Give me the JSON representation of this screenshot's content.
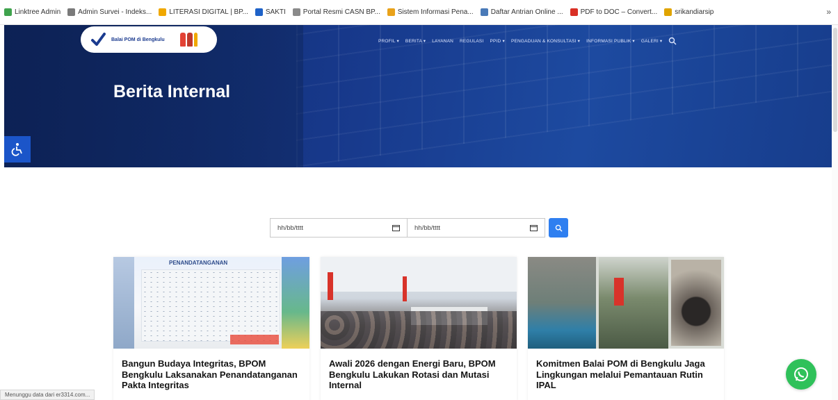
{
  "bookmarks": [
    {
      "label": "Linktree Admin",
      "color": "#3fa34d"
    },
    {
      "label": "Admin Survei - Indeks...",
      "color": "#7a7a7a"
    },
    {
      "label": "LITERASI DIGITAL | BP...",
      "color": "#f0a800"
    },
    {
      "label": "SAKTI",
      "color": "#1e62c8"
    },
    {
      "label": "Portal Resmi CASN BP...",
      "color": "#8a8a8a"
    },
    {
      "label": "Sistem Informasi Pena...",
      "color": "#e9a21a"
    },
    {
      "label": "Daftar Antrian Online ...",
      "color": "#4a7ab8"
    },
    {
      "label": "PDF to DOC – Convert...",
      "color": "#d93025"
    },
    {
      "label": "srikandiarsip",
      "color": "#e0a400"
    }
  ],
  "bookmarks_more": "»",
  "header": {
    "logo_text": "Balai POM di Bengkulu",
    "nav": [
      "PROFIL ▾",
      "BERITA ▾",
      "LAYANAN",
      "REGULASI",
      "PPID ▾",
      "PENGADUAN & KONSULTASI ▾",
      "INFORMASI PUBLIK ▾",
      "GALERI ▾"
    ]
  },
  "hero": {
    "title": "Berita Internal"
  },
  "filter": {
    "start_placeholder": "hh/bb/tttt",
    "end_placeholder": "hh/bb/tttt"
  },
  "cards": [
    {
      "title": "Bangun Budaya Integritas, BPOM Bengkulu Laksanakan Penandatanganan Pakta Integritas",
      "image_caption": "PENANDATANGANAN"
    },
    {
      "title": "Awali 2026 dengan Energi Baru, BPOM Bengkulu Lakukan Rotasi dan Mutasi Internal"
    },
    {
      "title": "Komitmen Balai POM di Bengkulu Jaga Lingkungan melalui Pemantauan Rutin IPAL"
    }
  ],
  "status_bar": "Menunggu data dari er3314.com...",
  "colors": {
    "hero": "#17388a",
    "accent": "#2f7ff0",
    "whatsapp": "#2fc15a"
  }
}
